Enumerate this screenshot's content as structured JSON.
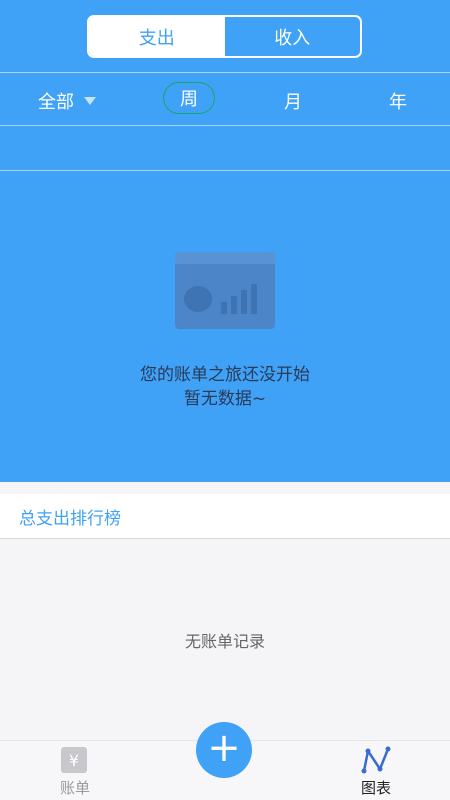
{
  "segment": {
    "expense": "支出",
    "income": "收入",
    "selected": "支出"
  },
  "filter": {
    "category": "全部"
  },
  "periods": {
    "week": "周",
    "month": "月",
    "year": "年",
    "selected": "周"
  },
  "empty_state": {
    "line1": "您的账单之旅还没开始",
    "line2": "暂无数据~"
  },
  "ranking": {
    "title": "总支出排行榜",
    "empty": "无账单记录"
  },
  "tabbar": {
    "bill": "账单",
    "bill_icon_glyph": "¥",
    "chart": "图表",
    "add_symbol": "+"
  },
  "colors": {
    "primary": "#3fa2f7",
    "selected_ring": "#1aa56f",
    "tab_inactive": "#9a9aa0",
    "tab_active": "#222222"
  }
}
